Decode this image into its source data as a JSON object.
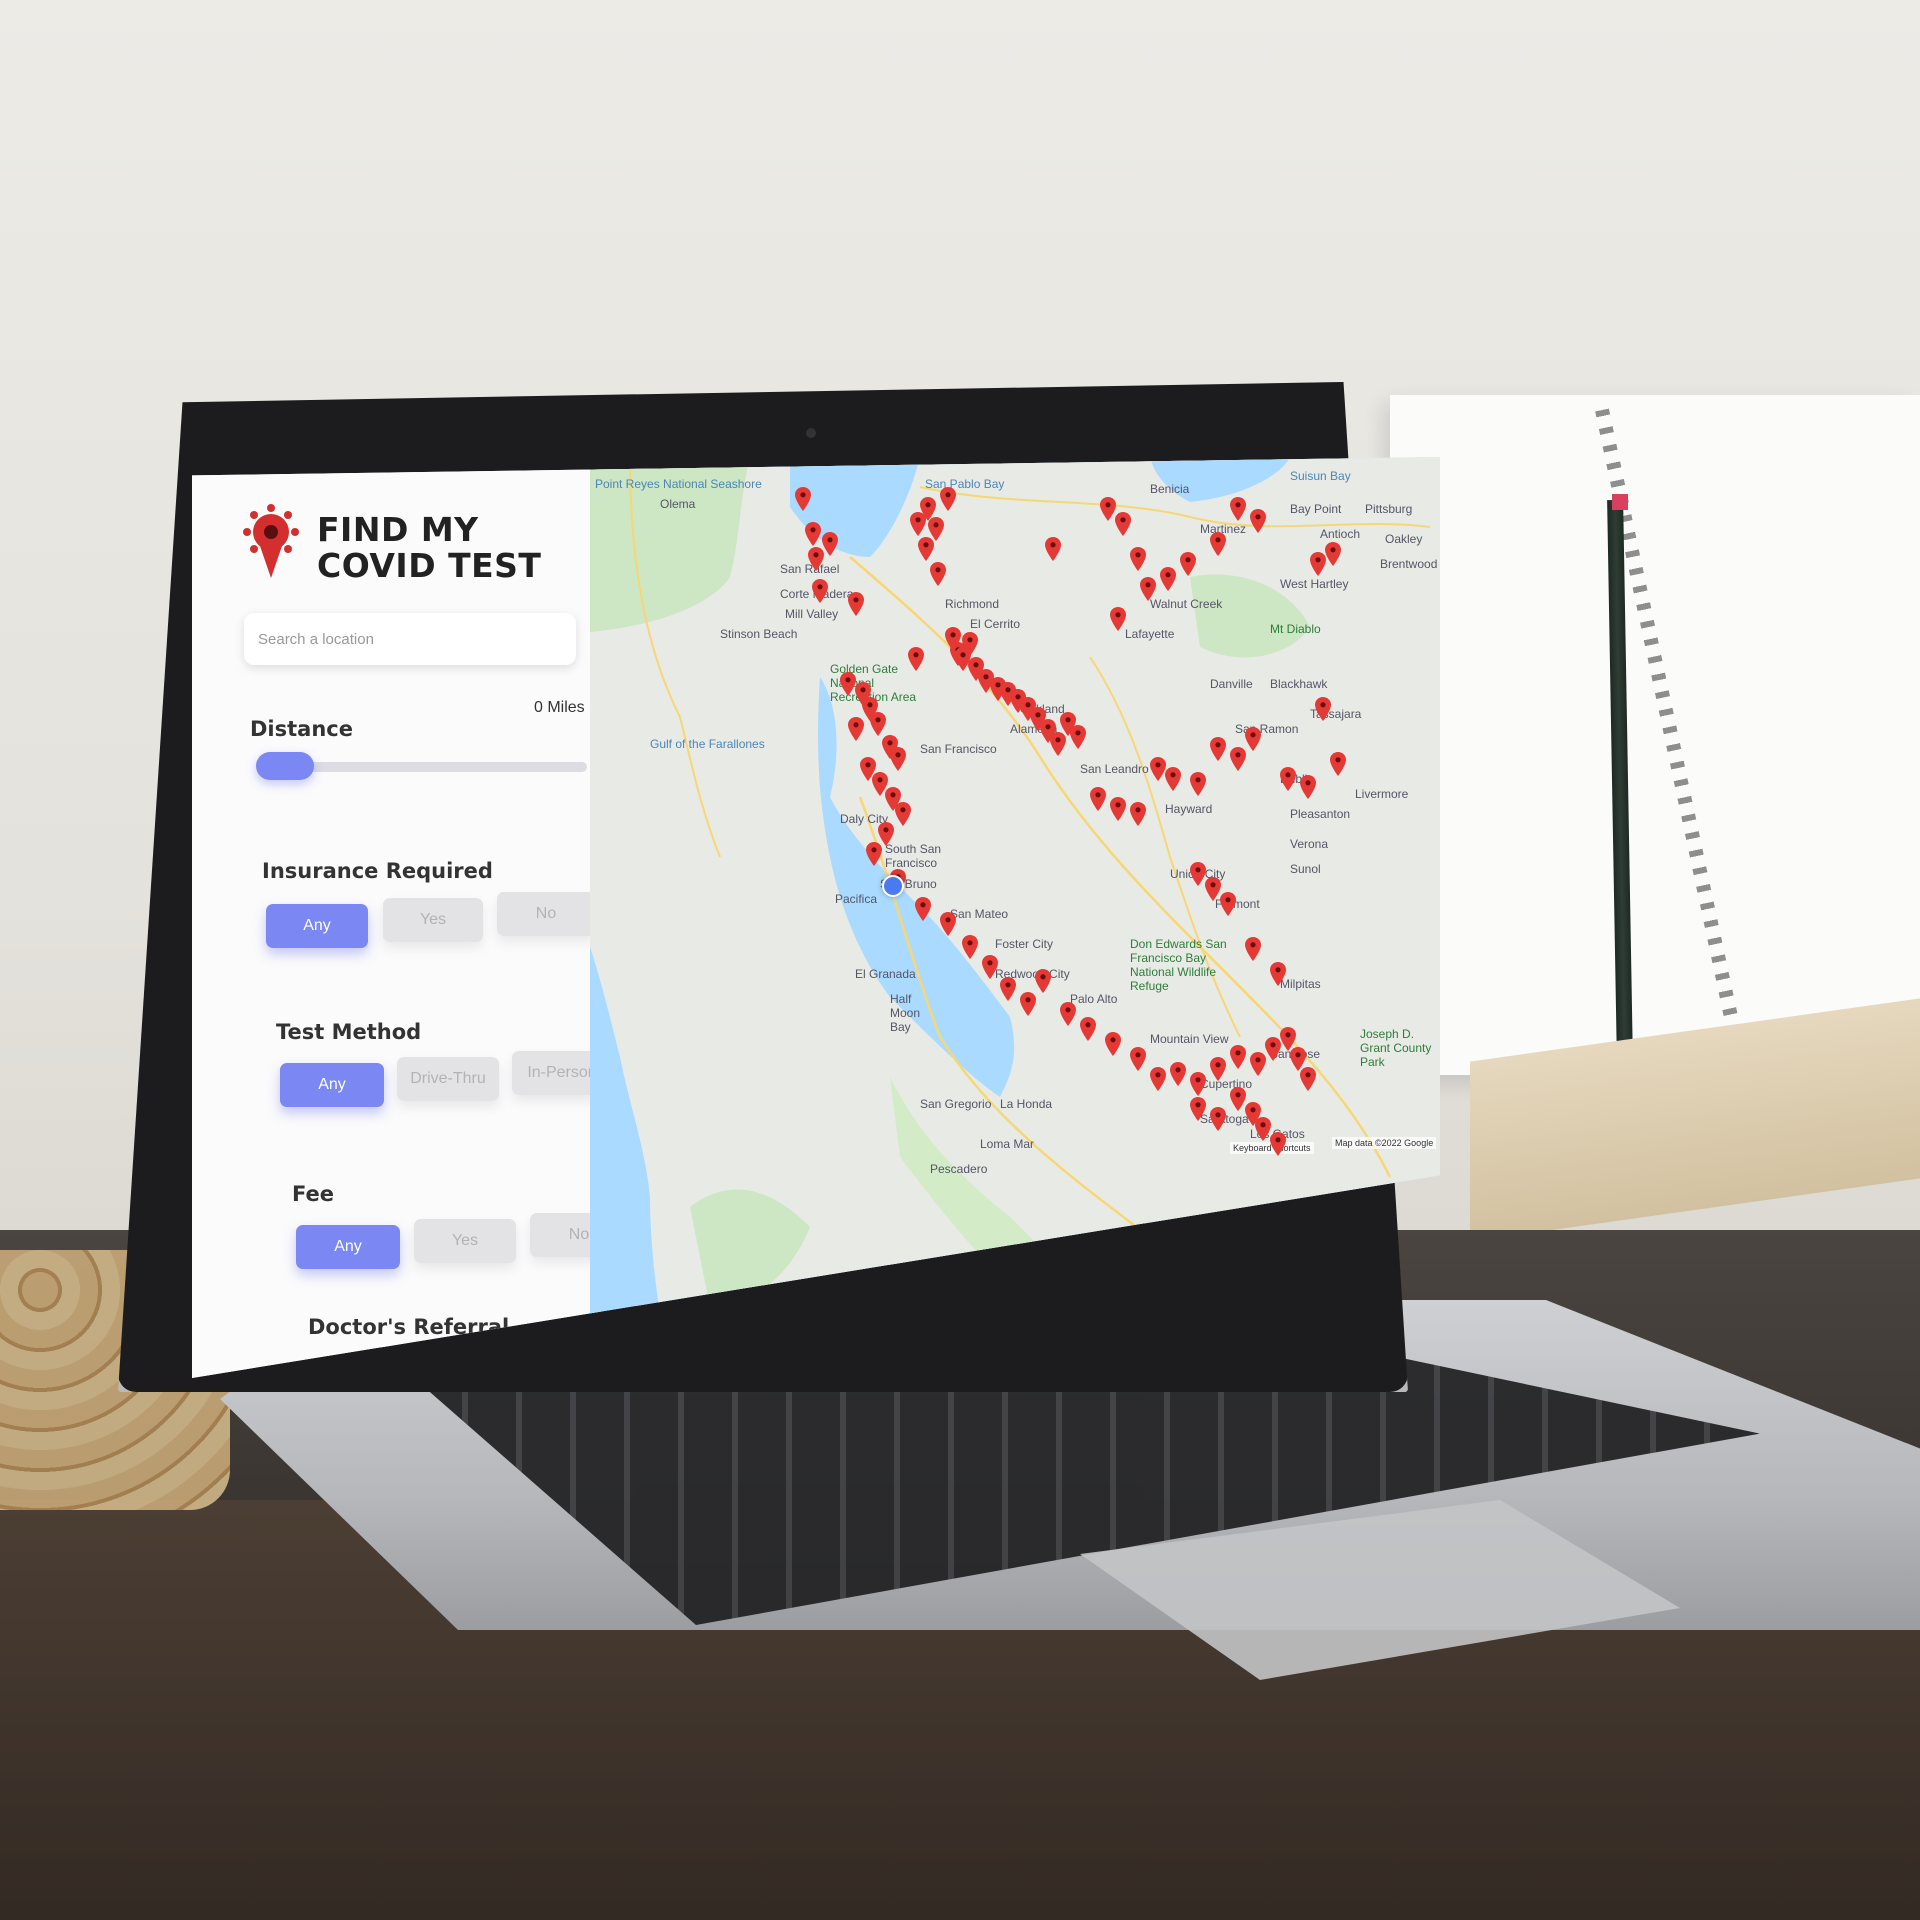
{
  "app": {
    "brand_line1": "FIND MY",
    "brand_line2": "COVID TEST"
  },
  "search": {
    "placeholder": "Search a location"
  },
  "filters": {
    "distance": {
      "label": "Distance",
      "value": "0 Miles"
    },
    "insurance": {
      "label": "Insurance Required",
      "options": [
        "Any",
        "Yes",
        "No"
      ],
      "selected": "Any"
    },
    "test_method": {
      "label": "Test Method",
      "options": [
        "Any",
        "Drive-Thru",
        "In-Person"
      ],
      "selected": "Any"
    },
    "fee": {
      "label": "Fee",
      "options": [
        "Any",
        "Yes",
        "No"
      ],
      "selected": "Any"
    },
    "doctors_referral": {
      "label": "Doctor's Referral"
    }
  },
  "map": {
    "places": {
      "point_reyes": "Point Reyes National Seashore",
      "olema": "Olema",
      "san_pablo_bay": "San Pablo Bay",
      "benicia": "Benicia",
      "suisun_bay": "Suisun Bay",
      "bay_point": "Bay Point",
      "pittsburg": "Pittsburg",
      "martinez": "Martinez",
      "antioch": "Antioch",
      "oakley": "Oakley",
      "san_rafael": "San Rafael",
      "corte_madera": "Corte Madera",
      "mill_valley": "Mill Valley",
      "stinson_beach": "Stinson Beach",
      "richmond": "Richmond",
      "el_cerrito": "El Cerrito",
      "walnut_creek": "Walnut Creek",
      "lafayette": "Lafayette",
      "west_hartley": "West Hartley",
      "brentwood": "Brentwood",
      "mt_diablo": "Mt Diablo",
      "golden_gate": "Golden Gate National Recreation Area",
      "farallones": "Gulf of the Farallones",
      "san_francisco": "San Francisco",
      "oakland": "Oakland",
      "alameda": "Alameda",
      "danville": "Danville",
      "blackhawk": "Blackhawk",
      "san_ramon": "San Ramon",
      "tassajara": "Tassajara",
      "san_leandro": "San Leandro",
      "hayward": "Hayward",
      "dublin": "Dublin",
      "livermore": "Livermore",
      "pleasanton": "Pleasanton",
      "daly_city": "Daly City",
      "south_sf": "South San Francisco",
      "san_bruno": "San Bruno",
      "pacifica": "Pacifica",
      "verona": "Verona",
      "union_city": "Union City",
      "sunol": "Sunol",
      "san_mateo": "San Mateo",
      "fremont": "Fremont",
      "foster_city": "Foster City",
      "don_edwards": "Don Edwards San Francisco Bay National Wildlife Refuge",
      "el_granada": "El Granada",
      "half_moon_bay": "Half Moon Bay",
      "redwood_city": "Redwood City",
      "palo_alto": "Palo Alto",
      "milpitas": "Milpitas",
      "mountain_view": "Mountain View",
      "san_jose": "San Jose",
      "joseph_grant": "Joseph D. Grant County Park",
      "cupertino": "Cupertino",
      "san_gregorio": "San Gregorio",
      "la_honda": "La Honda",
      "saratoga": "Saratoga",
      "loma_mar": "Loma Mar",
      "pescadero": "Pescadero",
      "los_gatos": "Los Gatos"
    },
    "credits": {
      "shortcuts": "Keyboard shortcuts",
      "data": "Map data ©2022 Google"
    },
    "pin_color": "#e53935",
    "user_location_color": "#4a7af0"
  },
  "colors": {
    "accent": "#7b87f2",
    "inactive": "#e3e3e6"
  }
}
